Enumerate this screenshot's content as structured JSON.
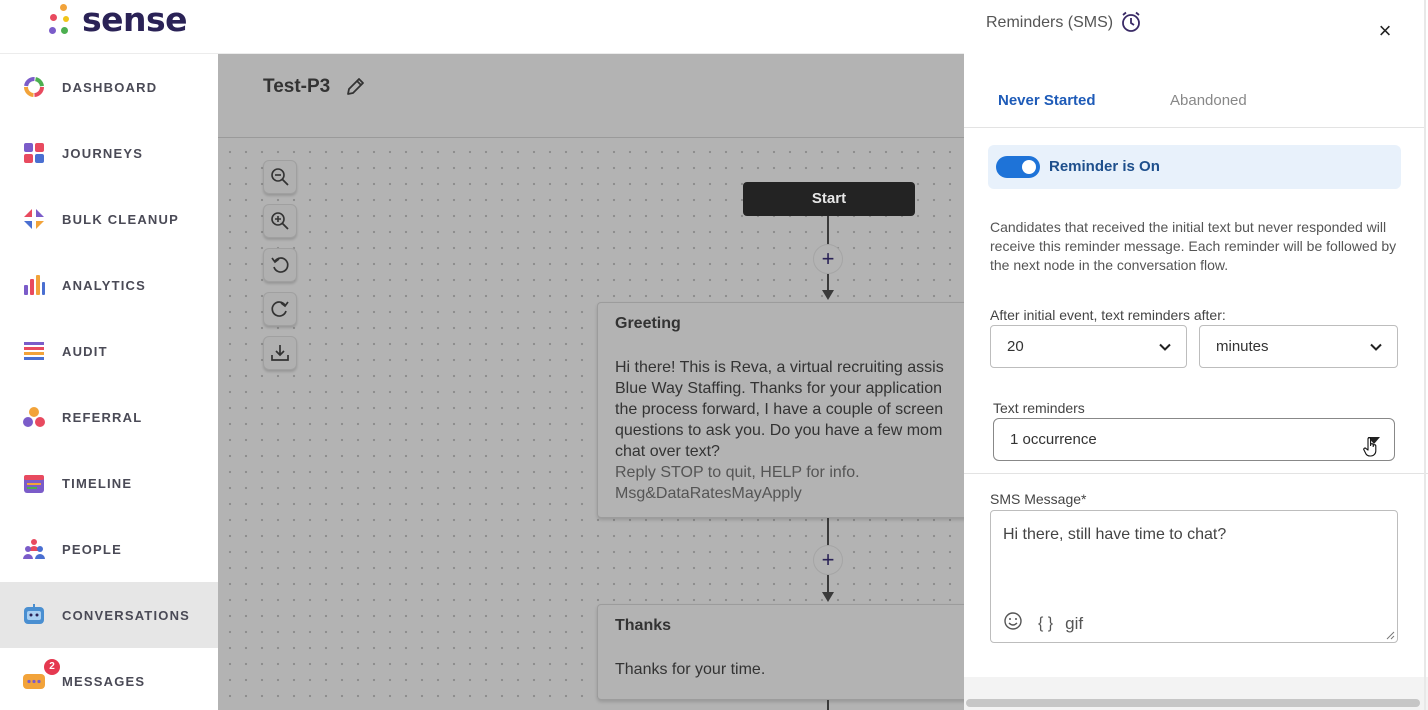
{
  "app": {
    "brand": "sense"
  },
  "sidebar": {
    "items": [
      {
        "label": "DASHBOARD",
        "icon": "dashboard-icon"
      },
      {
        "label": "JOURNEYS",
        "icon": "journeys-icon"
      },
      {
        "label": "BULK CLEANUP",
        "icon": "bulk-cleanup-icon"
      },
      {
        "label": "ANALYTICS",
        "icon": "analytics-icon"
      },
      {
        "label": "AUDIT",
        "icon": "audit-icon"
      },
      {
        "label": "REFERRAL",
        "icon": "referral-icon"
      },
      {
        "label": "TIMELINE",
        "icon": "timeline-icon"
      },
      {
        "label": "PEOPLE",
        "icon": "people-icon"
      },
      {
        "label": "CONVERSATIONS",
        "icon": "conversations-icon",
        "active": true
      },
      {
        "label": "MESSAGES",
        "icon": "messages-icon",
        "badge": "2"
      }
    ]
  },
  "flow": {
    "title": "Test-P3",
    "start_label": "Start",
    "nodes": [
      {
        "title": "Greeting",
        "body": "Hi there! This is Reva, a virtual recruiting assis\nBlue Way Staffing. Thanks for your application\nthe process forward, I have a couple of screen\nquestions to ask you. Do you have a few mom\nchat over text?",
        "footer": "Reply STOP to quit, HELP for info.\nMsg&DataRatesMayApply"
      },
      {
        "title": "Thanks",
        "body": "Thanks for your time."
      }
    ]
  },
  "panel": {
    "title": "Reminders (SMS)",
    "close": "×",
    "tabs": [
      {
        "label": "Never Started",
        "active": true
      },
      {
        "label": "Abandoned",
        "active": false
      }
    ],
    "toggle": {
      "label": "Reminder is On",
      "on": true
    },
    "description": "Candidates that received the initial text but never responded will receive this reminder message. Each reminder will be followed by the next node in the conversation flow.",
    "after_label": "After initial event, text reminders after:",
    "after_value": "20",
    "after_unit": "minutes",
    "reminders_label": "Text reminders",
    "reminders_value": "1 occurrence",
    "sms_label": "SMS Message*",
    "sms_value": "Hi there, still have time to chat?",
    "gif_label": "gif",
    "variables_label": "{ }"
  },
  "colors": {
    "accent": "#1e73d8",
    "tab_active": "#1e5bb8",
    "brand": "#2a2256",
    "badge": "#e53950"
  }
}
